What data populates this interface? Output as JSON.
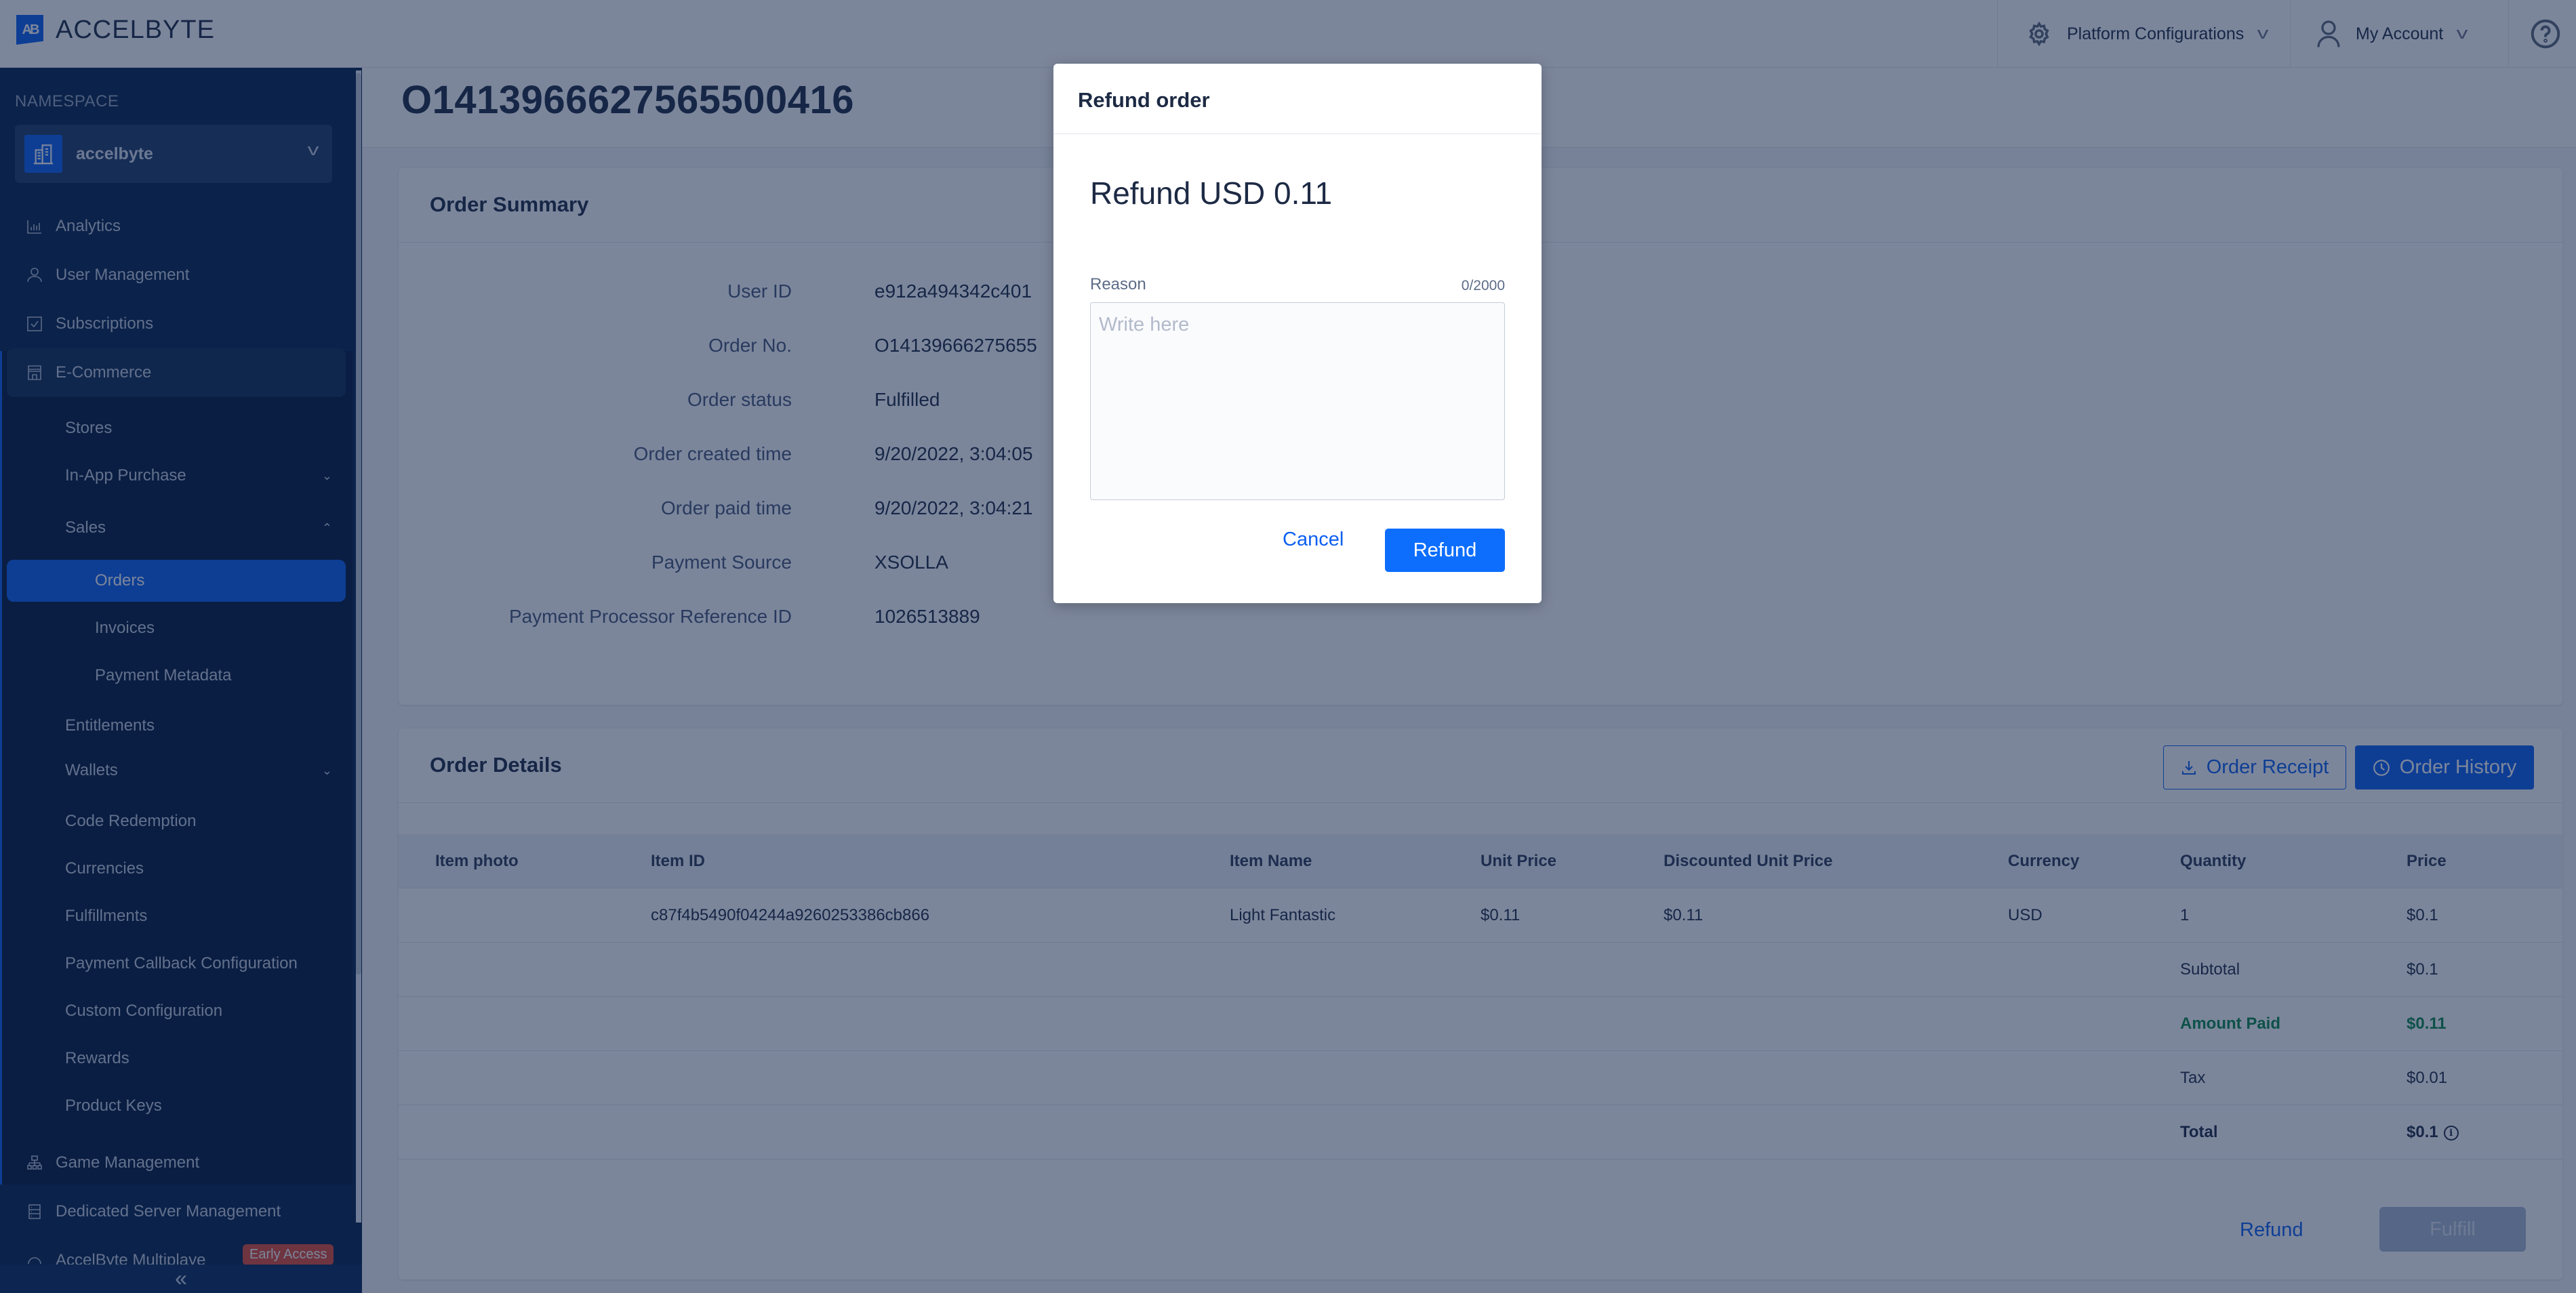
{
  "header": {
    "brand": "ACCELBYTE",
    "brand_mark": "AB",
    "platform_configurations": "Platform Configurations",
    "my_account": "My Account"
  },
  "sidebar": {
    "namespace_label": "NAMESPACE",
    "namespace_value": "accelbyte",
    "items": [
      {
        "label": "Analytics",
        "icon": "chart-bar-icon"
      },
      {
        "label": "User Management",
        "icon": "user-icon"
      },
      {
        "label": "Subscriptions",
        "icon": "checkbox-icon"
      },
      {
        "label": "E-Commerce",
        "icon": "store-icon",
        "expanded": true
      }
    ],
    "ecommerce_children": [
      {
        "label": "Stores"
      },
      {
        "label": "In-App Purchase",
        "chevron": "down"
      },
      {
        "label": "Sales",
        "chevron": "up"
      },
      {
        "label": "Orders",
        "level": 2,
        "active": true
      },
      {
        "label": "Invoices",
        "level": 2
      },
      {
        "label": "Payment Metadata",
        "level": 2
      },
      {
        "label": "Entitlements"
      },
      {
        "label": "Wallets",
        "chevron": "down"
      },
      {
        "label": "Code Redemption"
      },
      {
        "label": "Currencies"
      },
      {
        "label": "Fulfillments"
      },
      {
        "label": "Payment Callback Configuration"
      },
      {
        "label": "Custom Configuration"
      },
      {
        "label": "Rewards"
      },
      {
        "label": "Product Keys"
      }
    ],
    "bottom_items": [
      {
        "label": "Game Management",
        "icon": "hierarchy-icon"
      },
      {
        "label": "Dedicated Server Management",
        "icon": "server-icon"
      },
      {
        "label": "AccelByte Multiplaye",
        "icon": "cloud-icon",
        "badge": "Early Access"
      }
    ],
    "collapse_glyph": "«"
  },
  "main": {
    "title": "O141396662756550041­6",
    "order_summary": {
      "title": "Order Summary",
      "rows": [
        {
          "label": "User ID",
          "value": "e912a494342c401"
        },
        {
          "label": "Order No.",
          "value": "O14139666275655"
        },
        {
          "label": "Order status",
          "value": "Fulfilled"
        },
        {
          "label": "Order created time",
          "value": "9/20/2022, 3:04:05"
        },
        {
          "label": "Order paid time",
          "value": "9/20/2022, 3:04:21"
        },
        {
          "label": "Payment Source",
          "value": "XSOLLA"
        },
        {
          "label": "Payment Processor Reference ID",
          "value": "1026513889"
        }
      ]
    },
    "order_details": {
      "title": "Order Details",
      "order_receipt_label": "Order Receipt",
      "order_history_label": "Order History",
      "columns": [
        "Item photo",
        "Item ID",
        "Item Name",
        "Unit Price",
        "Discounted Unit Price",
        "Currency",
        "Quantity",
        "Price"
      ],
      "rows": [
        {
          "item_photo": "",
          "item_id": "c87f4b5490f04244a9260253386cb866",
          "item_name": "Light Fantastic",
          "unit_price": "$0.11",
          "discounted_unit_price": "$0.11",
          "currency": "USD",
          "quantity": "1",
          "price": "$0.1"
        }
      ],
      "totals": [
        {
          "label": "Subtotal",
          "value": "$0.1"
        },
        {
          "label": "Amount Paid",
          "value": "$0.11",
          "highlight": true
        },
        {
          "label": "Tax",
          "value": "$0.01"
        },
        {
          "label": "Total",
          "value": "$0.1",
          "bold": true,
          "info": true
        }
      ],
      "refund_label": "Refund",
      "fulfill_label": "Fulfill"
    }
  },
  "modal": {
    "title": "Refund order",
    "amount_text": "Refund USD 0.11",
    "reason_label": "Reason",
    "reason_count": "0/2000",
    "reason_placeholder": "Write here",
    "reason_value": "",
    "cancel_label": "Cancel",
    "refund_label": "Refund"
  },
  "colors": {
    "primary": "#0d5ff0",
    "sidebar_bg": "#06224d",
    "amount_paid": "#0c8a4a",
    "badge": "#e04b37"
  }
}
